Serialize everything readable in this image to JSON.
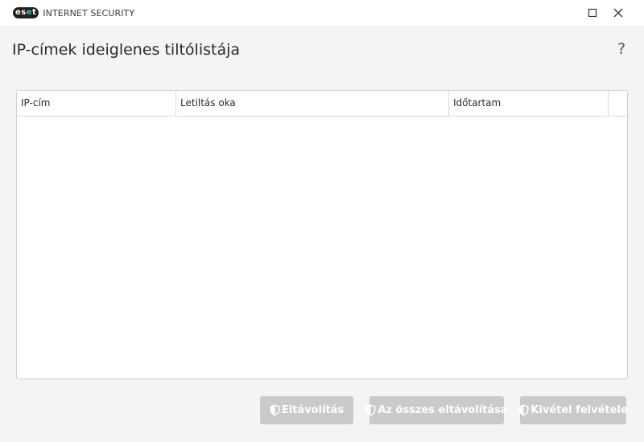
{
  "titlebar": {
    "logo_text_1": "es",
    "logo_text_2": "e",
    "logo_text_3": "t",
    "product_name": "INTERNET SECURITY"
  },
  "page": {
    "title": "IP-címek ideiglenes tiltólistája",
    "help_label": "?"
  },
  "table": {
    "columns": [
      "IP-cím",
      "Letiltás oka",
      "Időtartam",
      ""
    ],
    "rows": []
  },
  "buttons": {
    "remove": "Eltávolítás",
    "remove_all": "Az összes eltávolítása",
    "add_exception": "Kivétel felvétele"
  },
  "colors": {
    "accent": "#38c5b8",
    "button_disabled": "#c9cacc",
    "background": "#f3f4f5"
  },
  "icons": {
    "maximize": "maximize-icon",
    "close": "close-icon",
    "button": "shield-icon"
  }
}
